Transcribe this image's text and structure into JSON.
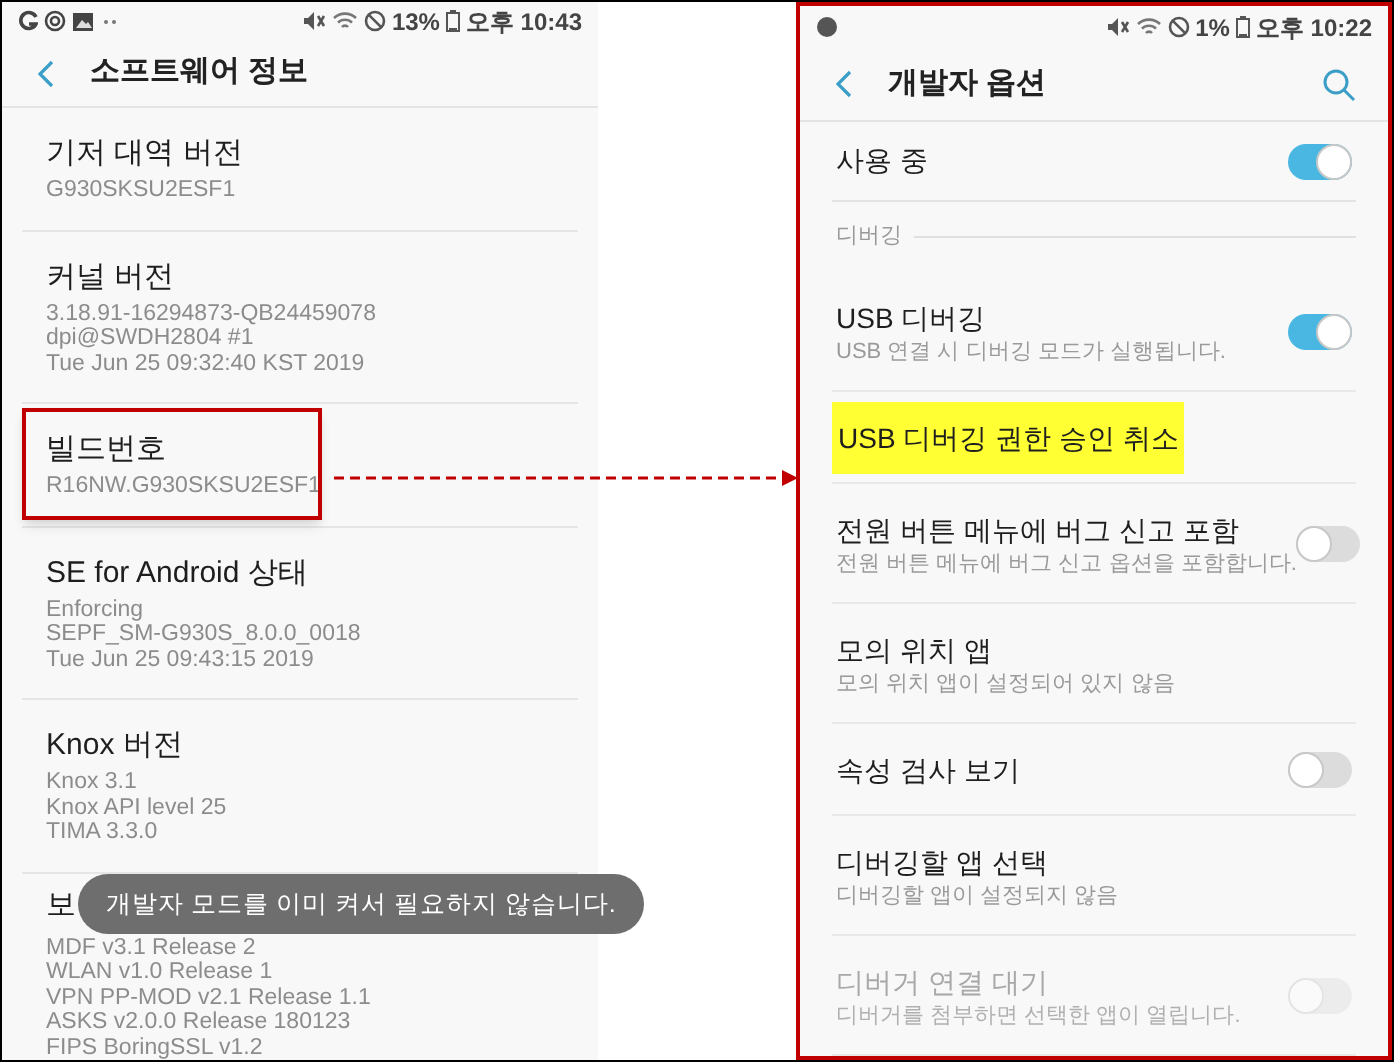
{
  "left_screen": {
    "status_bar": {
      "battery": "13%",
      "time": "오후 10:43"
    },
    "title": "소프트웨어 정보",
    "items": [
      {
        "title": "기저 대역 버전",
        "lines": [
          "G930SKSU2ESF1"
        ],
        "annotated": false
      },
      {
        "title": "커널 버전",
        "lines": [
          "3.18.91-16294873-QB24459078",
          "dpi@SWDH2804 #1",
          "Tue Jun 25 09:32:40 KST 2019"
        ],
        "annotated": false
      },
      {
        "title": "빌드번호",
        "lines": [
          "R16NW.G930SKSU2ESF1"
        ],
        "annotated": true
      },
      {
        "title": "SE for Android 상태",
        "lines": [
          "Enforcing",
          "SEPF_SM-G930S_8.0.0_0018",
          "Tue Jun 25 09:43:15 2019"
        ],
        "annotated": false
      },
      {
        "title": "Knox 버전",
        "lines": [
          "Knox 3.1",
          "Knox API level 25",
          "TIMA 3.3.0"
        ],
        "annotated": false
      },
      {
        "title": "보",
        "lines": [
          "MDF v3.1 Release 2",
          "WLAN v1.0 Release 1",
          "VPN PP-MOD v2.1 Release 1.1",
          "ASKS v2.0.0 Release 180123",
          "FIPS BoringSSL v1.2"
        ],
        "annotated": false
      }
    ],
    "toast": "개발자 모드를 이미 켜서 필요하지 않습니다."
  },
  "right_screen": {
    "status_bar": {
      "battery": "1%",
      "time": "오후 10:22"
    },
    "title": "개발자 옵션",
    "items": [
      {
        "kind": "master",
        "title": "사용 중",
        "on": true
      },
      {
        "kind": "section",
        "title": "디버깅"
      },
      {
        "kind": "toggle",
        "title": "USB 디버깅",
        "subtitle": "USB 연결 시 디버깅 모드가 실행됩니다.",
        "on": true,
        "disabled": false
      },
      {
        "kind": "text",
        "title": "USB 디버깅 권한 승인 취소",
        "highlighted": true,
        "disabled": false
      },
      {
        "kind": "toggle",
        "title": "전원 버튼 메뉴에 버그 신고 포함",
        "subtitle": "전원 버튼 메뉴에 버그 신고 옵션을 포함합니다.",
        "on": false,
        "disabled": false
      },
      {
        "kind": "text",
        "title": "모의 위치 앱",
        "subtitle": "모의 위치 앱이 설정되어 있지 않음",
        "highlighted": false,
        "disabled": false
      },
      {
        "kind": "toggle",
        "title": "속성 검사 보기",
        "on": false,
        "disabled": false
      },
      {
        "kind": "text",
        "title": "디버깅할 앱 선택",
        "subtitle": "디버깅할 앱이 설정되지 않음",
        "highlighted": false,
        "disabled": false
      },
      {
        "kind": "toggle",
        "title": "디버거 연결 대기",
        "subtitle": "디버거를 첨부하면 선택한 앱이 열립니다.",
        "on": false,
        "disabled": true
      }
    ]
  }
}
